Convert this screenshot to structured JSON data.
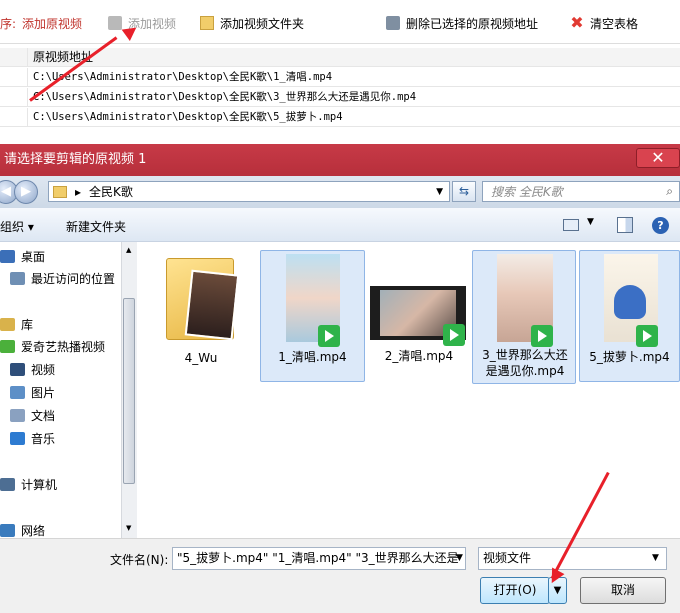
{
  "app": {
    "toolbar": {
      "add_original_prefix": "序:",
      "add_original": "添加原视频",
      "add_video": "添加视频",
      "add_folder": "添加视频文件夹",
      "delete_selected": "删除已选择的原视频地址",
      "clear_table": "清空表格"
    },
    "table": {
      "header": "原视频地址",
      "rows": [
        "C:\\Users\\Administrator\\Desktop\\全民K歌\\1_清唱.mp4",
        "C:\\Users\\Administrator\\Desktop\\全民K歌\\3_世界那么大还是遇见你.mp4",
        "C:\\Users\\Administrator\\Desktop\\全民K歌\\5_拔萝卜.mp4"
      ]
    }
  },
  "dialog": {
    "title": "请选择要剪辑的原视频 1",
    "close": "✕",
    "address": {
      "sep": "▸",
      "folder": "全民K歌"
    },
    "search_placeholder": "搜索 全民K歌",
    "toolbar": {
      "organize": "组织 ▾",
      "new_folder": "新建文件夹"
    },
    "nav": [
      {
        "label": "桌面",
        "icon": "desktop-icon",
        "color": "#3b6fb8"
      },
      {
        "label": "最近访问的位置",
        "icon": "recent-places-icon",
        "color": "#6f8fb4"
      },
      {
        "label": "库",
        "icon": "libraries-icon",
        "color": "#d9b24b"
      },
      {
        "label": "爱奇艺热播视频",
        "icon": "iqiyi-icon",
        "color": "#4bb03b"
      },
      {
        "label": "视频",
        "icon": "video-library-icon",
        "color": "#2f4f7a"
      },
      {
        "label": "图片",
        "icon": "pictures-library-icon",
        "color": "#5d8fc7"
      },
      {
        "label": "文档",
        "icon": "documents-library-icon",
        "color": "#8aa1c0"
      },
      {
        "label": "音乐",
        "icon": "music-library-icon",
        "color": "#2d7bd1"
      },
      {
        "label": "计算机",
        "icon": "computer-icon",
        "color": "#4d6e93"
      },
      {
        "label": "网络",
        "icon": "network-icon",
        "color": "#3a7bbd"
      }
    ],
    "files": [
      {
        "name": "4_Wu",
        "type": "folder",
        "selected": false
      },
      {
        "name": "1_清唱.mp4",
        "type": "video",
        "selected": true
      },
      {
        "name": "2_清唱.mp4",
        "type": "video",
        "selected": false
      },
      {
        "name": "3_世界那么大还是遇见你.mp4",
        "type": "video",
        "selected": true
      },
      {
        "name": "5_拔萝卜.mp4",
        "type": "video",
        "selected": true
      }
    ],
    "footer": {
      "filename_label": "文件名(N):",
      "filename_value": "\"5_拔萝卜.mp4\" \"1_清唱.mp4\" \"3_世界那么大还是",
      "filetype": "视频文件",
      "open": "打开(O)",
      "cancel": "取消"
    }
  },
  "colors": {
    "title_bar": "#c0343f",
    "selection": "#dce9f9",
    "annotation_arrow": "#e8202a",
    "add_original_text": "#c0342d"
  }
}
